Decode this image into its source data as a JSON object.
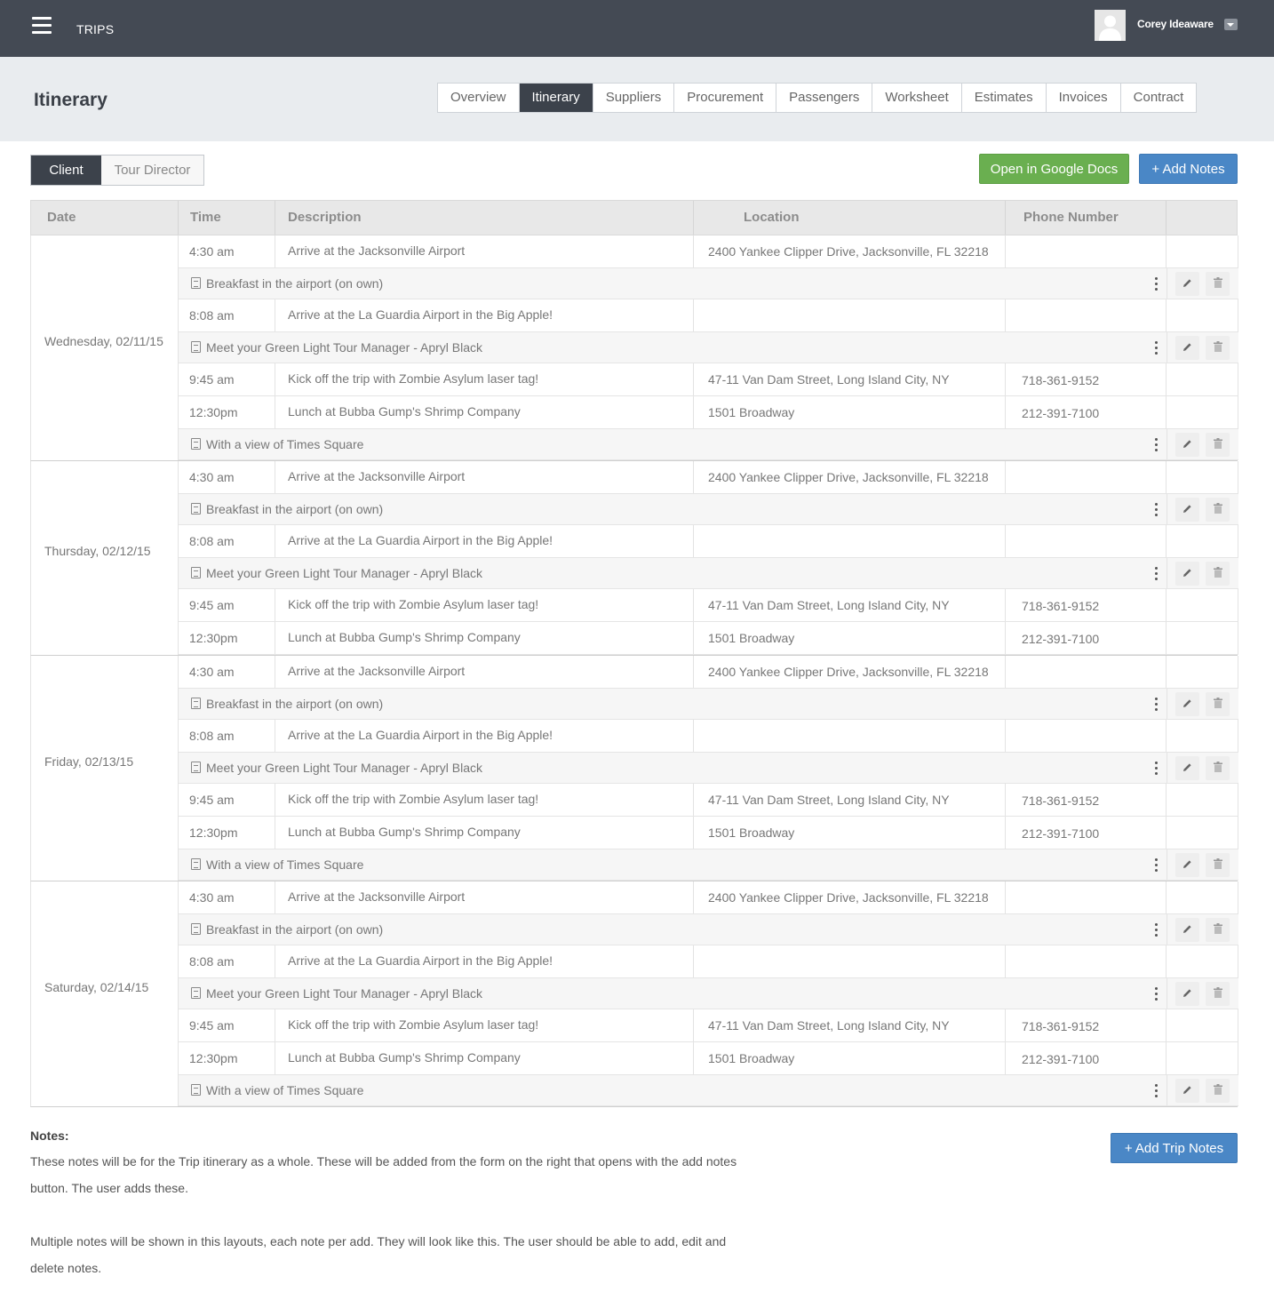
{
  "topbar": {
    "app_title": "TRIPS",
    "user_name": "Corey Ideaware"
  },
  "page": {
    "title": "Itinerary"
  },
  "tabs": [
    {
      "label": "Overview",
      "active": false
    },
    {
      "label": "Itinerary",
      "active": true
    },
    {
      "label": "Suppliers",
      "active": false
    },
    {
      "label": "Procurement",
      "active": false
    },
    {
      "label": "Passengers",
      "active": false
    },
    {
      "label": "Worksheet",
      "active": false
    },
    {
      "label": "Estimates",
      "active": false
    },
    {
      "label": "Invoices",
      "active": false
    },
    {
      "label": "Contract",
      "active": false
    }
  ],
  "toggle": {
    "client": "Client",
    "tour_director": "Tour Director"
  },
  "actions": {
    "google_docs": "Open in Google Docs",
    "add_notes": "+ Add Notes",
    "add_trip_notes": "+ Add Trip Notes"
  },
  "columns": {
    "date": "Date",
    "time": "Time",
    "description": "Description",
    "location": "Location",
    "phone": "Phone Number"
  },
  "days": [
    {
      "date": "Wednesday, 02/11/15",
      "rows": [
        {
          "type": "event",
          "time": "4:30 am",
          "description": "Arrive at the Jacksonville Airport",
          "location": "2400 Yankee Clipper Drive, Jacksonville, FL 32218",
          "phone": ""
        },
        {
          "type": "note",
          "text": "Breakfast in the airport (on own)"
        },
        {
          "type": "event",
          "time": "8:08 am",
          "description": "Arrive at the La Guardia Airport in the Big Apple!",
          "location": "",
          "phone": ""
        },
        {
          "type": "note",
          "text": "Meet your Green Light Tour Manager - Apryl Black"
        },
        {
          "type": "event",
          "time": "9:45 am",
          "description": "Kick off the trip with Zombie Asylum laser tag!",
          "location": "47-11 Van Dam Street, Long Island City, NY",
          "phone": "718-361-9152"
        },
        {
          "type": "event",
          "time": "12:30pm",
          "description": "Lunch at Bubba Gump's Shrimp Company",
          "location": "1501 Broadway",
          "phone": "212-391-7100"
        },
        {
          "type": "note",
          "text": "With a view of Times Square"
        }
      ]
    },
    {
      "date": "Thursday, 02/12/15",
      "rows": [
        {
          "type": "event",
          "time": "4:30 am",
          "description": "Arrive at the Jacksonville Airport",
          "location": "2400 Yankee Clipper Drive, Jacksonville, FL 32218",
          "phone": ""
        },
        {
          "type": "note",
          "text": "Breakfast in the airport (on own)"
        },
        {
          "type": "event",
          "time": "8:08 am",
          "description": "Arrive at the La Guardia Airport in the Big Apple!",
          "location": "",
          "phone": ""
        },
        {
          "type": "note",
          "text": "Meet your Green Light Tour Manager - Apryl Black"
        },
        {
          "type": "event",
          "time": "9:45 am",
          "description": "Kick off the trip with Zombie Asylum laser tag!",
          "location": "47-11 Van Dam Street, Long Island City, NY",
          "phone": "718-361-9152"
        },
        {
          "type": "event",
          "time": "12:30pm",
          "description": "Lunch at Bubba Gump's Shrimp Company",
          "location": "1501 Broadway",
          "phone": "212-391-7100"
        }
      ]
    },
    {
      "date": "Friday, 02/13/15",
      "rows": [
        {
          "type": "event",
          "time": "4:30 am",
          "description": "Arrive at the Jacksonville Airport",
          "location": "2400 Yankee Clipper Drive, Jacksonville, FL 32218",
          "phone": ""
        },
        {
          "type": "note",
          "text": "Breakfast in the airport (on own)"
        },
        {
          "type": "event",
          "time": "8:08 am",
          "description": "Arrive at the La Guardia Airport in the Big Apple!",
          "location": "",
          "phone": ""
        },
        {
          "type": "note",
          "text": "Meet your Green Light Tour Manager - Apryl Black"
        },
        {
          "type": "event",
          "time": "9:45 am",
          "description": "Kick off the trip with Zombie Asylum laser tag!",
          "location": "47-11 Van Dam Street, Long Island City, NY",
          "phone": "718-361-9152"
        },
        {
          "type": "event",
          "time": "12:30pm",
          "description": "Lunch at Bubba Gump's Shrimp Company",
          "location": "1501 Broadway",
          "phone": "212-391-7100"
        },
        {
          "type": "note",
          "text": "With a view of Times Square"
        }
      ]
    },
    {
      "date": "Saturday, 02/14/15",
      "rows": [
        {
          "type": "event",
          "time": "4:30 am",
          "description": "Arrive at the Jacksonville Airport",
          "location": "2400 Yankee Clipper Drive, Jacksonville, FL 32218",
          "phone": ""
        },
        {
          "type": "note",
          "text": "Breakfast in the airport (on own)"
        },
        {
          "type": "event",
          "time": "8:08 am",
          "description": "Arrive at the La Guardia Airport in the Big Apple!",
          "location": "",
          "phone": ""
        },
        {
          "type": "note",
          "text": "Meet your Green Light Tour Manager - Apryl Black"
        },
        {
          "type": "event",
          "time": "9:45 am",
          "description": "Kick off the trip with Zombie Asylum laser tag!",
          "location": "47-11 Van Dam Street, Long Island City, NY",
          "phone": "718-361-9152"
        },
        {
          "type": "event",
          "time": "12:30pm",
          "description": "Lunch at Bubba Gump's Shrimp Company",
          "location": "1501 Broadway",
          "phone": "212-391-7100"
        },
        {
          "type": "note",
          "text": "With a view of Times Square"
        }
      ]
    }
  ],
  "notes": {
    "title": "Notes:",
    "paragraphs": [
      "These notes will be for the Trip itinerary as a whole. These will be added from the form on the right that opens with the add notes button. The user adds these.",
      "Multiple notes will be shown in this layouts, each note per add. They will look like this. The user should be able to add, edit and delete notes."
    ]
  },
  "colors": {
    "topbar": "#444a54",
    "active_tab": "#3c424b",
    "green_button": "#6aaf50",
    "blue_button": "#4a87c6",
    "header_band": "#e9ecef"
  },
  "icons": {
    "menu": "hamburger-icon",
    "user": "avatar-icon",
    "dropdown": "caret-down-icon",
    "note": "notepad-icon",
    "more": "kebab-menu-icon",
    "edit": "pencil-icon",
    "delete": "trash-icon"
  }
}
